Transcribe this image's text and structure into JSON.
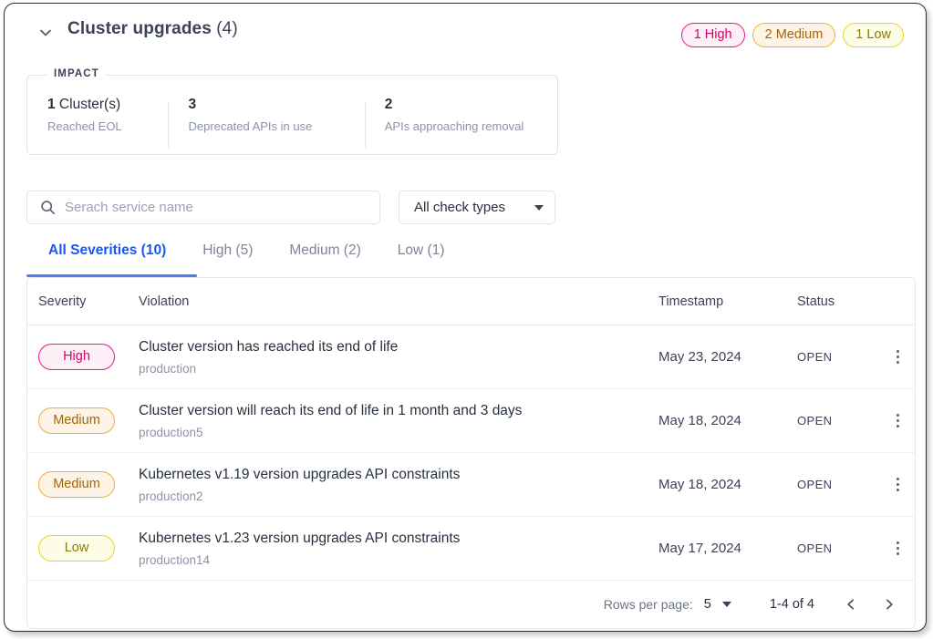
{
  "header": {
    "title_name": "Cluster upgrades",
    "title_count": "(4)",
    "chevron_icon": "chevron-down-icon",
    "severity_pills": [
      {
        "label": "1 High",
        "kind": "high",
        "color": "#d6006e"
      },
      {
        "label": "2 Medium",
        "kind": "medium",
        "color": "#a2660a"
      },
      {
        "label": "1 Low",
        "kind": "low",
        "color": "#8a7a09"
      }
    ]
  },
  "impact": {
    "legend": "IMPACT",
    "items": [
      {
        "value_strong": "1",
        "value_rest": " Cluster(s)",
        "label": "Reached EOL"
      },
      {
        "value_strong": "3",
        "value_rest": "",
        "label": "Deprecated APIs in use"
      },
      {
        "value_strong": "2",
        "value_rest": "",
        "label": "APIs approaching removal"
      }
    ]
  },
  "filters": {
    "search": {
      "placeholder": "Serach service name",
      "value": "",
      "icon": "search-icon"
    },
    "check_types": {
      "selected": "All check types",
      "options": [
        "All check types"
      ]
    }
  },
  "tabs": [
    {
      "label": "All Severities (10)",
      "active": true
    },
    {
      "label": "High (5)",
      "active": false
    },
    {
      "label": "Medium (2)",
      "active": false
    },
    {
      "label": "Low (1)",
      "active": false
    }
  ],
  "table": {
    "columns": [
      "Severity",
      "Violation",
      "Timestamp",
      "Status"
    ],
    "rows": [
      {
        "severity": "High",
        "violation": "Cluster version has reached its end of life",
        "service": "production",
        "timestamp": "May 23, 2024",
        "status": "OPEN"
      },
      {
        "severity": "Medium",
        "violation": "Cluster version will reach its end of life in 1 month and 3 days",
        "service": "production5",
        "timestamp": "May 18, 2024",
        "status": "OPEN"
      },
      {
        "severity": "Medium",
        "violation": "Kubernetes v1.19 version upgrades API constraints",
        "service": "production2",
        "timestamp": "May 18, 2024",
        "status": "OPEN"
      },
      {
        "severity": "Low",
        "violation": "Kubernetes v1.23 version upgrades API constraints",
        "service": "production14",
        "timestamp": "May 17, 2024",
        "status": "OPEN"
      }
    ]
  },
  "pagination": {
    "rows_per_page_label": "Rows per page:",
    "rows_per_page_value": "5",
    "range": "1-4 of 4",
    "prev_icon": "chevron-left-icon",
    "next_icon": "chevron-right-icon"
  }
}
